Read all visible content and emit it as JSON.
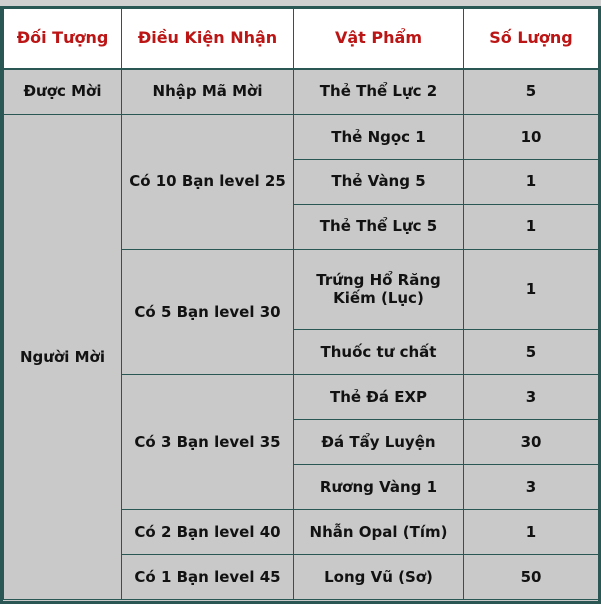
{
  "theme": {
    "header_text_color": "#bc1515",
    "border_color": "#2a5754",
    "cell_background": "#c9c9c9",
    "header_background": "#ffffff",
    "body_text_color": "#121212",
    "top_strip_color": "#d0d0d0"
  },
  "table": {
    "headers": [
      "Đối Tượng",
      "Điều Kiện Nhận",
      "Vật Phẩm",
      "Số Lượng"
    ],
    "groups": [
      {
        "target": "Được Mời",
        "conditions": [
          {
            "condition": "Nhập Mã Mời",
            "rewards": [
              {
                "item": "Thẻ Thể Lực 2",
                "quantity": "5"
              }
            ]
          }
        ]
      },
      {
        "target": "Người Mời",
        "conditions": [
          {
            "condition": "Có 10 Bạn level 25",
            "rewards": [
              {
                "item": "Thẻ Ngọc 1",
                "quantity": "10"
              },
              {
                "item": "Thẻ Vàng 5",
                "quantity": "1"
              },
              {
                "item": "Thẻ Thể Lực 5",
                "quantity": "1"
              }
            ]
          },
          {
            "condition": "Có 5 Bạn level 30",
            "rewards": [
              {
                "item": "Trứng Hổ Răng Kiếm (Lục)",
                "quantity": "1"
              },
              {
                "item": "Thuốc tư chất",
                "quantity": "5"
              }
            ]
          },
          {
            "condition": "Có 3 Bạn level 35",
            "rewards": [
              {
                "item": "Thẻ Đá EXP",
                "quantity": "3"
              },
              {
                "item": "Đá Tẩy Luyện",
                "quantity": "30"
              },
              {
                "item": "Rương Vàng 1",
                "quantity": "3"
              }
            ]
          },
          {
            "condition": "Có 2 Bạn level 40",
            "rewards": [
              {
                "item": "Nhẫn Opal (Tím)",
                "quantity": "1"
              }
            ]
          },
          {
            "condition": "Có 1 Bạn level 45",
            "rewards": [
              {
                "item": "Long Vũ (Sơ)",
                "quantity": "50"
              }
            ]
          }
        ]
      }
    ]
  }
}
